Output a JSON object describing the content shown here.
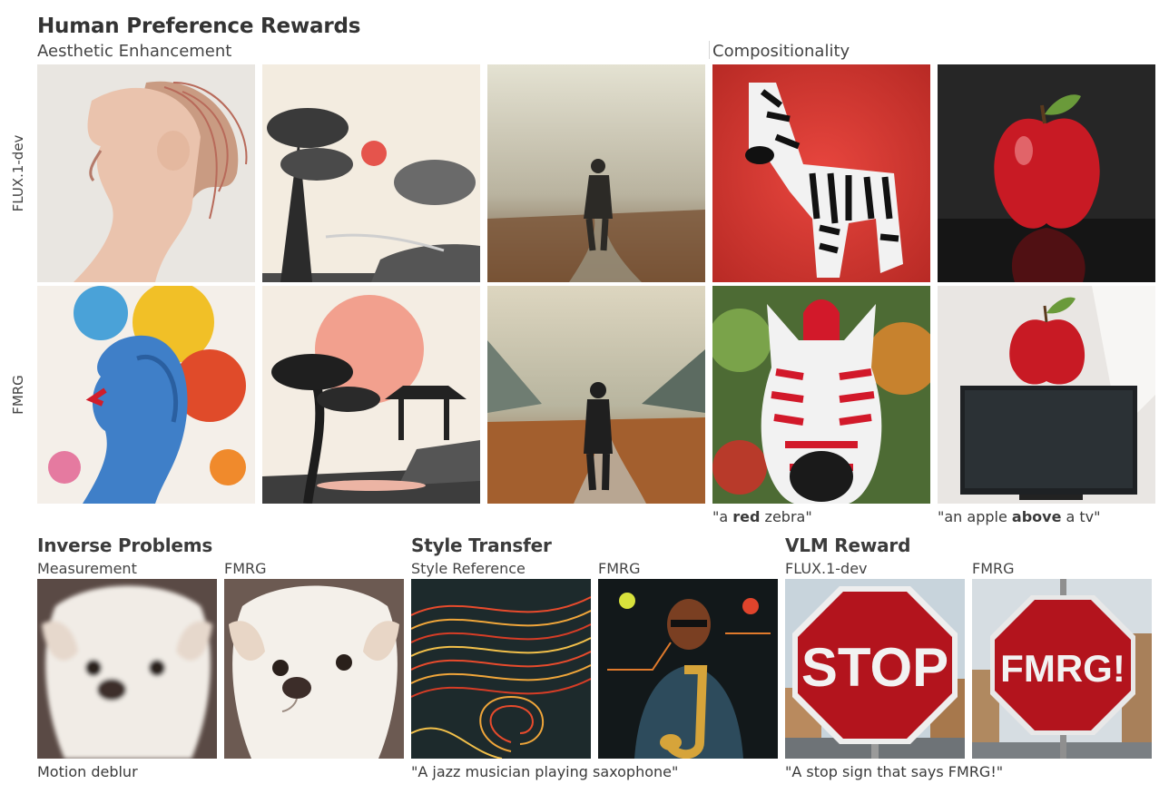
{
  "figure": {
    "title": "Human Preference Rewards",
    "aesthetic": {
      "subtitle": "Aesthetic Enhancement"
    },
    "compositionality": {
      "subtitle": "Compositionality",
      "captions": [
        {
          "pre": "\"a ",
          "bold": "red",
          "post": " zebra\""
        },
        {
          "pre": "\"an apple ",
          "bold": "above",
          "post": " a tv\""
        }
      ]
    },
    "rows": {
      "top": "FLUX.1-dev",
      "bottom": "FMRG"
    },
    "inverse": {
      "title": "Inverse Problems",
      "labels": [
        "Measurement",
        "FMRG"
      ],
      "caption": "Motion deblur"
    },
    "style": {
      "title": "Style Transfer",
      "labels": [
        "Style Reference",
        "FMRG"
      ],
      "caption": "\"A jazz musician playing saxophone\""
    },
    "vlm": {
      "title": "VLM Reward",
      "labels": [
        "FLUX.1-dev",
        "FMRG"
      ],
      "caption": "\"A stop sign that says FMRG!\"",
      "sign_left": "STOP",
      "sign_right": "FMRG!"
    }
  },
  "icons": [
    "portrait-image",
    "ink-landscape-image",
    "foggy-walker-image",
    "zebra-image",
    "apple-image",
    "stop-sign-image",
    "dog-image",
    "abstract-lines-image",
    "saxophone-image",
    "apple-on-tv-image"
  ],
  "colors": {
    "title": "#333333",
    "stop_red": "#b3141d",
    "zebra_bg": "#d8322e"
  }
}
